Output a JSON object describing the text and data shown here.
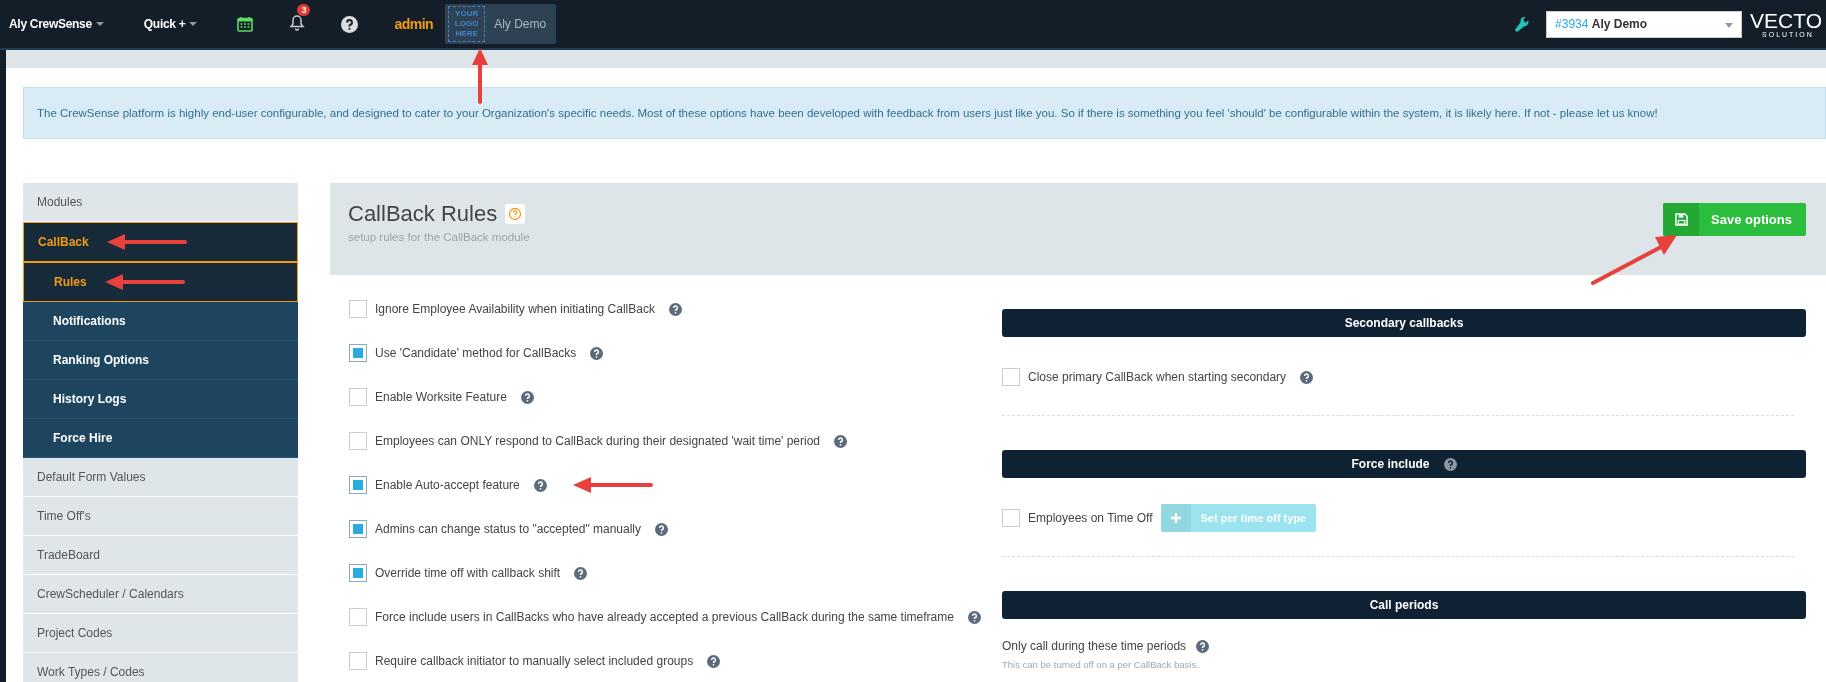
{
  "topbar": {
    "account_menu": "Aly CrewSense",
    "quick_menu": "Quick +",
    "notifications_count": "3",
    "admin_label": "admin",
    "logo_placeholder": "YOUR LOGO HERE",
    "org_name": "Aly Demo",
    "logo_arrow": true,
    "org_select": {
      "id": "#3934",
      "name": "Aly Demo"
    },
    "brand": {
      "name": "VECTO",
      "tagline": "SOLUTION"
    }
  },
  "banner": "The CrewSense platform is highly end-user configurable, and designed to cater to your Organization's specific needs. Most of these options have been developed with feedback from users just like you. So if there is something you feel 'should' be configurable within the system, it is likely here. If not - please let us know!",
  "sidebar": {
    "header": "Modules",
    "items": [
      {
        "label": "CallBack",
        "selected": true,
        "arrow": true,
        "children": [
          {
            "label": "Rules",
            "selected": true,
            "arrow": true
          },
          {
            "label": "Notifications",
            "selected": false,
            "arrow": false
          },
          {
            "label": "Ranking Options",
            "selected": false,
            "arrow": false
          },
          {
            "label": "History Logs",
            "selected": false,
            "arrow": false
          },
          {
            "label": "Force Hire",
            "selected": false,
            "arrow": false
          }
        ]
      },
      {
        "label": "Default Form Values",
        "selected": false,
        "arrow": false
      },
      {
        "label": "Time Off's",
        "selected": false,
        "arrow": false
      },
      {
        "label": "TradeBoard",
        "selected": false,
        "arrow": false
      },
      {
        "label": "CrewScheduler / Calendars",
        "selected": false,
        "arrow": false
      },
      {
        "label": "Project Codes",
        "selected": false,
        "arrow": false
      },
      {
        "label": "Work Types / Codes",
        "selected": false,
        "arrow": false
      }
    ]
  },
  "panel": {
    "title": "CallBack Rules",
    "subtitle": "setup rules for the CallBack module",
    "save_button": {
      "label": "Save options",
      "arrow": true
    }
  },
  "options": [
    {
      "label": "Ignore Employee Availability when initiating CallBack",
      "checked": false,
      "arrow": false
    },
    {
      "label": "Use 'Candidate' method for CallBacks",
      "checked": true,
      "arrow": false
    },
    {
      "label": "Enable Worksite Feature",
      "checked": false,
      "arrow": false
    },
    {
      "label": "Employees can ONLY respond to CallBack during their designated 'wait time' period",
      "checked": false,
      "arrow": false
    },
    {
      "label": "Enable Auto-accept feature",
      "checked": true,
      "arrow": true
    },
    {
      "label": "Admins can change status to \"accepted\" manually",
      "checked": true,
      "arrow": false
    },
    {
      "label": "Override time off with callback shift",
      "checked": true,
      "arrow": false
    },
    {
      "label": "Force include users in CallBacks who have already accepted a previous CallBack during the same timeframe",
      "checked": false,
      "arrow": false
    },
    {
      "label": "Require callback initiator to manually select included groups",
      "checked": false,
      "arrow": false
    }
  ],
  "sections": [
    {
      "title": "Secondary callbacks",
      "help": false,
      "options": [
        {
          "label": "Close primary CallBack when starting secondary",
          "checked": false,
          "help": true
        }
      ]
    },
    {
      "title": "Force include",
      "help": true,
      "options": [
        {
          "label": "Employees on Time Off",
          "checked": false,
          "help": false,
          "button": {
            "label": "Set per time off type",
            "disabled": true
          }
        }
      ]
    },
    {
      "title": "Call periods",
      "help": false,
      "periods": {
        "label": "Only call during these time periods",
        "note": "This can be turned off on a per CallBack basis."
      }
    }
  ]
}
